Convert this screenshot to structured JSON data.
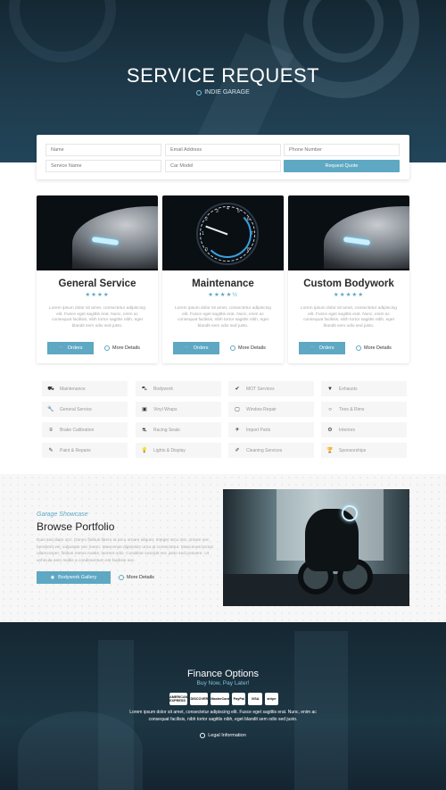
{
  "hero": {
    "title": "SERVICE REQUEST",
    "subtitle": "INDIE GARAGE"
  },
  "form": {
    "name_placeholder": "Name",
    "email_placeholder": "Email Address",
    "phone_placeholder": "Phone Number",
    "service_placeholder": "Service Name",
    "car_placeholder": "Car Model",
    "submit_label": "Request Quote"
  },
  "cards": [
    {
      "title": "General Service",
      "stars": "★★★★",
      "text": "Lorem ipsum dolor sit amet, consectetur adipiscing elit. Fusce eget sagittis erat. Nunc, enim ac consequat facilisis, nibh tortor sagittis nibh, eget blandit sem odio sed justo.",
      "orders": "Orders",
      "more": "More Details"
    },
    {
      "title": "Maintenance",
      "stars": "★★★★½",
      "text": "Lorem ipsum dolor sit amet, consectetur adipiscing elit. Fusce eget sagittis erat. Nunc, enim ac consequat facilisis, nibh tortor sagittis nibh, eget blandit sem odio sed justo.",
      "orders": "Orders",
      "more": "More Details"
    },
    {
      "title": "Custom Bodywork",
      "stars": "★★★★★",
      "text": "Lorem ipsum dolor sit amet, consectetur adipiscing elit. Fusce eget sagittis erat. Nunc, enim ac consequat facilisis, nibh tortor sagittis nibh, eget blandit sem odio sed justo.",
      "orders": "Orders",
      "more": "More Details"
    }
  ],
  "gauge_numbers": [
    "0",
    "1",
    "2",
    "3",
    "4",
    "5",
    "6",
    "7",
    "8"
  ],
  "categories": [
    {
      "label": "Maintenance",
      "icon": "car-icon",
      "glyph": "⛟"
    },
    {
      "label": "Bodywork",
      "icon": "car-front-icon",
      "glyph": "⛍"
    },
    {
      "label": "MOT Services",
      "icon": "check-circle-icon",
      "glyph": "✔"
    },
    {
      "label": "Exhausts",
      "icon": "filter-icon",
      "glyph": "▼"
    },
    {
      "label": "General Service",
      "icon": "wrench-icon",
      "glyph": "🔧"
    },
    {
      "label": "Vinyl Wraps",
      "icon": "image-icon",
      "glyph": "▣"
    },
    {
      "label": "Window Repair",
      "icon": "window-icon",
      "glyph": "▢"
    },
    {
      "label": "Tires & Rims",
      "icon": "tire-icon",
      "glyph": "○"
    },
    {
      "label": "Brake Calibration",
      "icon": "database-icon",
      "glyph": "≡"
    },
    {
      "label": "Racing Seats",
      "icon": "car-side-icon",
      "glyph": "⛐"
    },
    {
      "label": "Import Parts",
      "icon": "plane-icon",
      "glyph": "✈"
    },
    {
      "label": "Interiors",
      "icon": "cogs-icon",
      "glyph": "⚙"
    },
    {
      "label": "Paint & Repairs",
      "icon": "brush-icon",
      "glyph": "✎"
    },
    {
      "label": "Lights & Display",
      "icon": "bulb-icon",
      "glyph": "💡"
    },
    {
      "label": "Cleaning Services",
      "icon": "spray-icon",
      "glyph": "✐"
    },
    {
      "label": "Sponsorships",
      "icon": "trophy-icon",
      "glyph": "🏆"
    }
  ],
  "portfolio": {
    "kicker": "Garage Showcase",
    "title": "Browse Portfolio",
    "text": "Duis sed diam orci. Donec finibus libero ut arcu ornare aliquet. Integer arcu nisi, ornare nec hendrerit vel, vulputate nec lorem. Maecenas dignissim urna at consectetur. Maecenas lectus ullamcorper, finibus metus mattis, laoreet odio. Curabitur suscipit nec justo sed posuere. Ut vehicula sem mollis a condimentum est facilisis nec.",
    "gallery_label": "Bodywork Gallery",
    "more_label": "More Details"
  },
  "finance": {
    "title": "Finance Options",
    "subtitle": "Buy Now, Pay Later!",
    "payments": [
      "AMERICAN EXPRESS",
      "DISCOVER",
      "MasterCard",
      "PayPal",
      "VISA",
      "stripe"
    ],
    "text_line1": "Lorem ipsum dolor sit amet, consectetur adipiscing elit. Fusce eget sagittis erat. Nunc, enim ac",
    "text_line2": "consequat facilisis, nibh tortor sagittis nibh, eget blandit sem odio sed justo.",
    "legal_label": "Legal Information"
  },
  "colors": {
    "accent": "#5ea8c3",
    "hero_bg": "#1e3a4b",
    "finance_bg": "#1d3644"
  }
}
